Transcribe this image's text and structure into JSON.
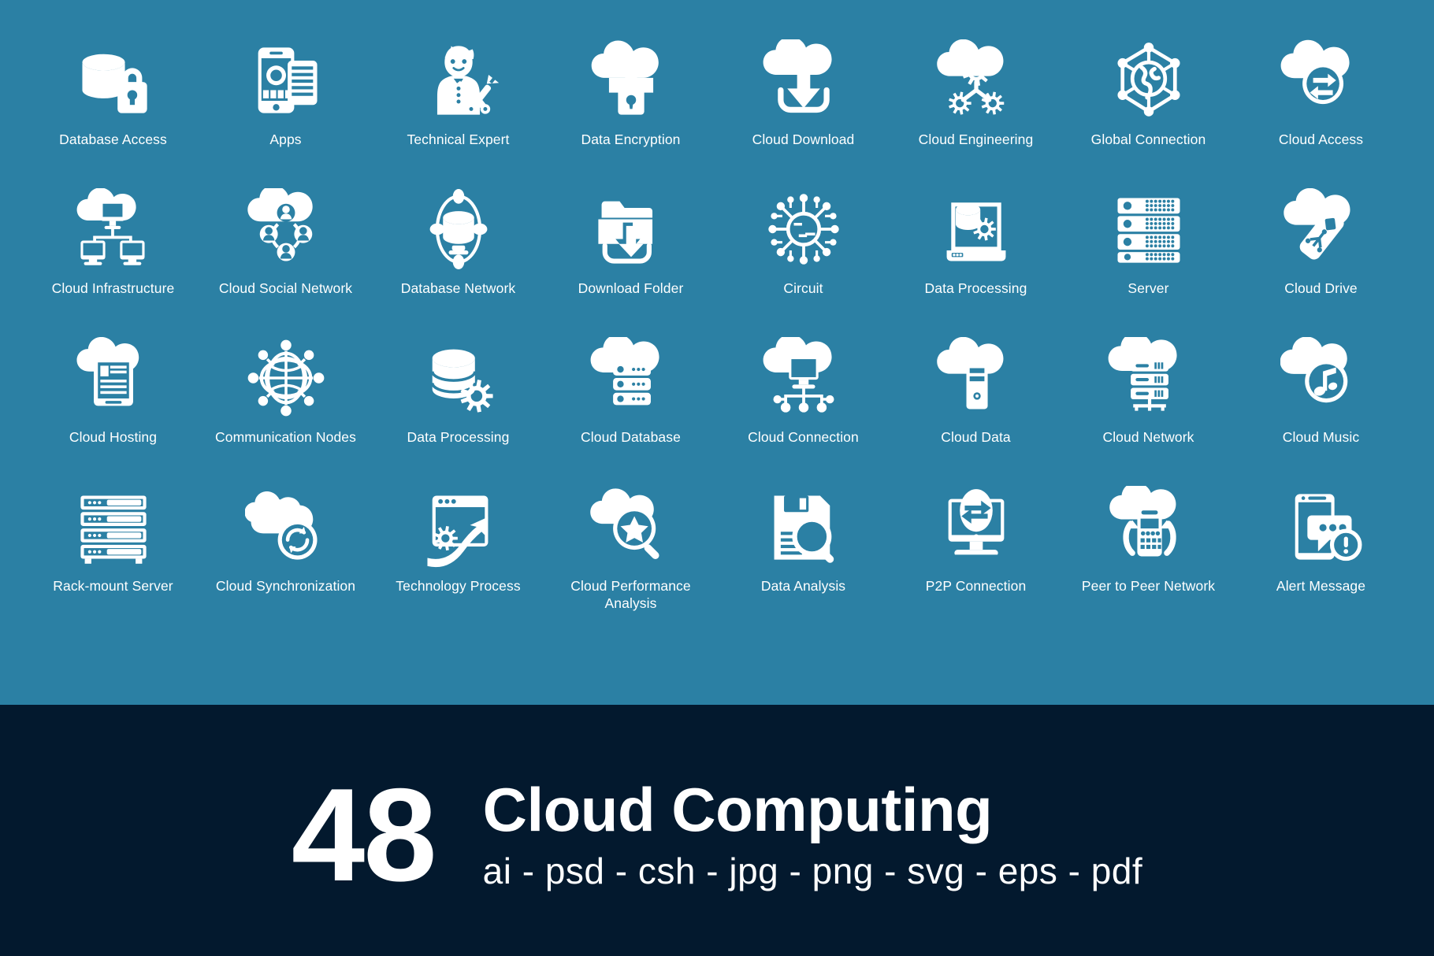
{
  "palette": {
    "panel_background": "#2b80a4",
    "banner_background": "#03192e",
    "icon_color": "#ffffff",
    "label_color": "#ffffff"
  },
  "icon_grid": {
    "columns": 8,
    "rows": 4,
    "items": [
      {
        "label": "Database Access",
        "icon": "database-lock-icon"
      },
      {
        "label": "Apps",
        "icon": "smartphone-apps-icon"
      },
      {
        "label": "Technical Expert",
        "icon": "technician-wrench-icon"
      },
      {
        "label": "Data Encryption",
        "icon": "cloud-folder-lock-icon"
      },
      {
        "label": "Cloud Download",
        "icon": "cloud-download-arrow-icon"
      },
      {
        "label": "Cloud Engineering",
        "icon": "cloud-gears-icon"
      },
      {
        "label": "Global Connection",
        "icon": "globe-network-hex-icon"
      },
      {
        "label": "Cloud Access",
        "icon": "cloud-exchange-arrows-icon"
      },
      {
        "label": "Cloud Infrastructure",
        "icon": "cloud-monitors-network-icon"
      },
      {
        "label": "Cloud Social Network",
        "icon": "cloud-users-network-icon"
      },
      {
        "label": "Database Network",
        "icon": "database-orbit-nodes-icon"
      },
      {
        "label": "Download Folder",
        "icon": "folder-download-tray-icon"
      },
      {
        "label": "Circuit",
        "icon": "circuit-chip-nodes-icon"
      },
      {
        "label": "Data Processing",
        "icon": "laptop-database-gear-icon"
      },
      {
        "label": "Server",
        "icon": "server-rack-icon"
      },
      {
        "label": "Cloud Drive",
        "icon": "cloud-usb-drive-icon"
      },
      {
        "label": "Cloud Hosting",
        "icon": "cloud-tablet-page-icon"
      },
      {
        "label": "Communication Nodes",
        "icon": "globe-nodes-ring-icon"
      },
      {
        "label": "Data Processing",
        "icon": "database-gear-icon"
      },
      {
        "label": "Cloud Database",
        "icon": "cloud-database-stack-icon"
      },
      {
        "label": "Cloud Connection",
        "icon": "cloud-monitor-nodes-icon"
      },
      {
        "label": "Cloud Data",
        "icon": "cloud-tower-pc-icon"
      },
      {
        "label": "Cloud Network",
        "icon": "cloud-server-network-icon"
      },
      {
        "label": "Cloud Music",
        "icon": "cloud-music-note-icon"
      },
      {
        "label": "Rack-mount Server",
        "icon": "rack-mount-server-icon"
      },
      {
        "label": "Cloud Synchronization",
        "icon": "cloud-sync-refresh-icon"
      },
      {
        "label": "Technology Process",
        "icon": "browser-gear-arrow-icon"
      },
      {
        "label": "Cloud Performance Analysis",
        "icon": "cloud-star-magnifier-icon"
      },
      {
        "label": "Data Analysis",
        "icon": "floppy-magnifier-icon"
      },
      {
        "label": "P2P Connection",
        "icon": "monitor-exchange-arrows-icon"
      },
      {
        "label": "Peer to Peer Network",
        "icon": "cloud-phone-sync-icon"
      },
      {
        "label": "Alert Message",
        "icon": "phone-chat-alert-icon"
      }
    ]
  },
  "banner": {
    "count": "48",
    "title": "Cloud Computing",
    "formats": "ai - psd - csh - jpg - png - svg - eps - pdf"
  }
}
